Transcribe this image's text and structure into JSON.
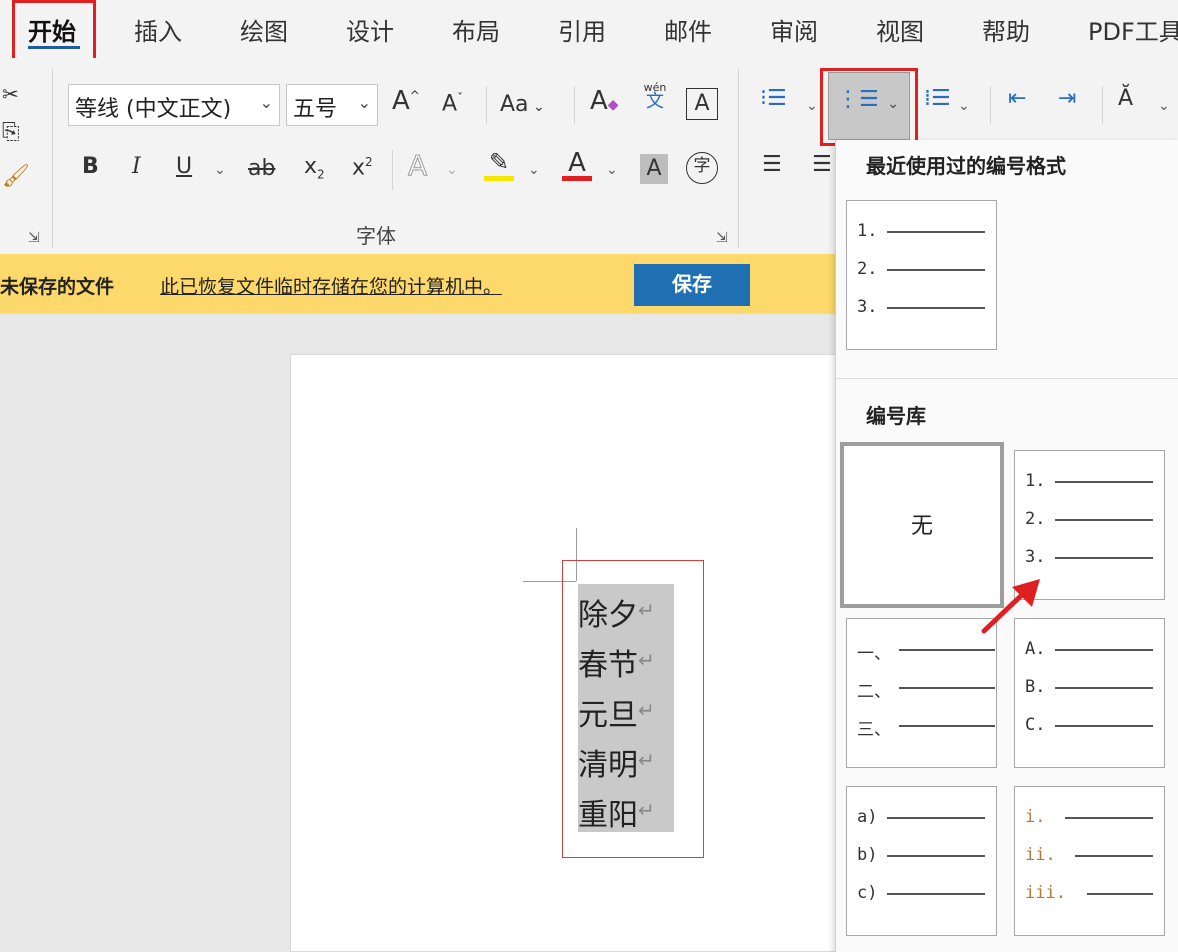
{
  "tabs": [
    {
      "label": "开始",
      "active": true
    },
    {
      "label": "插入"
    },
    {
      "label": "绘图"
    },
    {
      "label": "设计"
    },
    {
      "label": "布局"
    },
    {
      "label": "引用"
    },
    {
      "label": "邮件"
    },
    {
      "label": "审阅"
    },
    {
      "label": "视图"
    },
    {
      "label": "帮助"
    },
    {
      "label": "PDF工具"
    }
  ],
  "ribbon": {
    "font_name": "等线 (中文正文)",
    "font_size": "五号",
    "grow_font": "A",
    "shrink_font": "A",
    "change_case": "Aa",
    "clear_format": "A",
    "phonetic_top": "wén",
    "phonetic_bottom": "文",
    "char_border": "A",
    "bold": "B",
    "italic": "I",
    "underline": "U",
    "strike": "ab",
    "subscript": "x",
    "subscript_mark": "2",
    "superscript": "x",
    "superscript_mark": "2",
    "text_effect": "A",
    "font_color": "A",
    "char_shading": "A",
    "enclose": "字",
    "font_group_label": "字体",
    "highlight_color": "#f6e700",
    "font_color_value": "#e02020"
  },
  "infobar": {
    "title": "未保存的文件",
    "message": "此已恢复文件临时存储在您的计算机中。",
    "save_button": "保存"
  },
  "document": {
    "lines": [
      "除夕",
      "春节",
      "元旦",
      "清明",
      "重阳"
    ],
    "para_mark": "↵"
  },
  "numbering_panel": {
    "recent_title": "最近使用过的编号格式",
    "library_title": "编号库",
    "none_label": "无",
    "recent": [
      "1.",
      "2.",
      "3."
    ],
    "decimal": [
      "1.",
      "2.",
      "3."
    ],
    "chinese": [
      "一、",
      "二、",
      "三、"
    ],
    "upper_alpha": [
      "A.",
      "B.",
      "C."
    ],
    "lower_alpha": [
      "a)",
      "b)",
      "c)"
    ],
    "roman": [
      "i.",
      "ii.",
      "iii."
    ]
  }
}
